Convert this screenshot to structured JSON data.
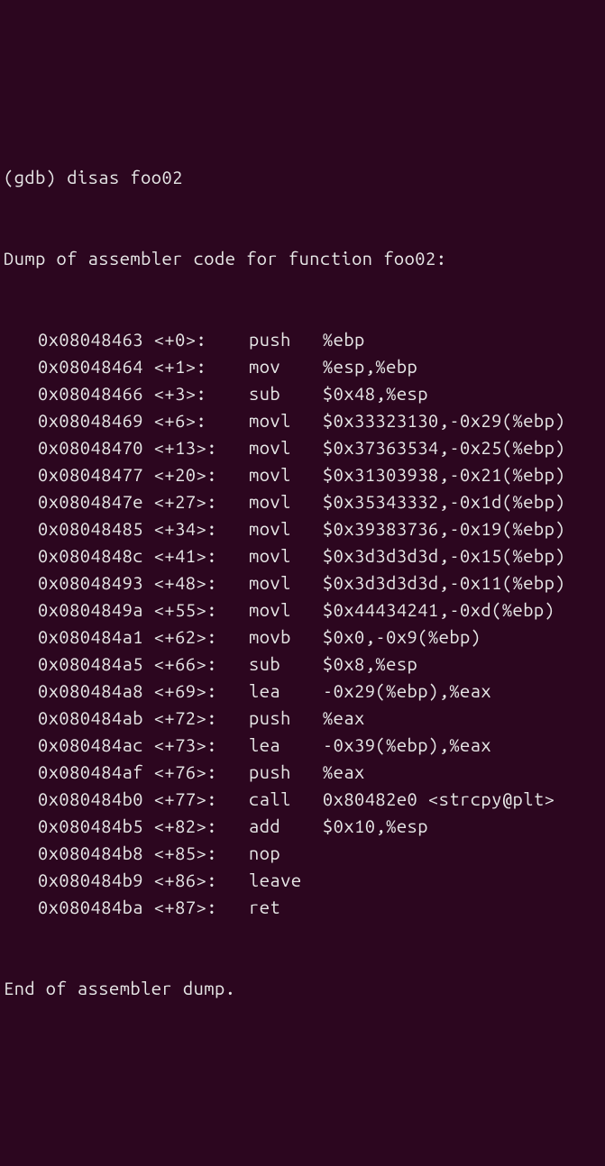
{
  "terminal": {
    "prompt": "(gdb) ",
    "command": "disas foo02",
    "header": "Dump of assembler code for function foo02:",
    "footer": "End of assembler dump.",
    "rows": [
      {
        "addr": "0x08048463",
        "offset": "<+0>:    ",
        "mnemonic": "push   ",
        "operands": "%ebp"
      },
      {
        "addr": "0x08048464",
        "offset": "<+1>:    ",
        "mnemonic": "mov    ",
        "operands": "%esp,%ebp"
      },
      {
        "addr": "0x08048466",
        "offset": "<+3>:    ",
        "mnemonic": "sub    ",
        "operands": "$0x48,%esp"
      },
      {
        "addr": "0x08048469",
        "offset": "<+6>:    ",
        "mnemonic": "movl   ",
        "operands": "$0x33323130,-0x29(%ebp)"
      },
      {
        "addr": "0x08048470",
        "offset": "<+13>:   ",
        "mnemonic": "movl   ",
        "operands": "$0x37363534,-0x25(%ebp)"
      },
      {
        "addr": "0x08048477",
        "offset": "<+20>:   ",
        "mnemonic": "movl   ",
        "operands": "$0x31303938,-0x21(%ebp)"
      },
      {
        "addr": "0x0804847e",
        "offset": "<+27>:   ",
        "mnemonic": "movl   ",
        "operands": "$0x35343332,-0x1d(%ebp)"
      },
      {
        "addr": "0x08048485",
        "offset": "<+34>:   ",
        "mnemonic": "movl   ",
        "operands": "$0x39383736,-0x19(%ebp)"
      },
      {
        "addr": "0x0804848c",
        "offset": "<+41>:   ",
        "mnemonic": "movl   ",
        "operands": "$0x3d3d3d3d,-0x15(%ebp)"
      },
      {
        "addr": "0x08048493",
        "offset": "<+48>:   ",
        "mnemonic": "movl   ",
        "operands": "$0x3d3d3d3d,-0x11(%ebp)"
      },
      {
        "addr": "0x0804849a",
        "offset": "<+55>:   ",
        "mnemonic": "movl   ",
        "operands": "$0x44434241,-0xd(%ebp)"
      },
      {
        "addr": "0x080484a1",
        "offset": "<+62>:   ",
        "mnemonic": "movb   ",
        "operands": "$0x0,-0x9(%ebp)"
      },
      {
        "addr": "0x080484a5",
        "offset": "<+66>:   ",
        "mnemonic": "sub    ",
        "operands": "$0x8,%esp"
      },
      {
        "addr": "0x080484a8",
        "offset": "<+69>:   ",
        "mnemonic": "lea    ",
        "operands": "-0x29(%ebp),%eax"
      },
      {
        "addr": "0x080484ab",
        "offset": "<+72>:   ",
        "mnemonic": "push   ",
        "operands": "%eax"
      },
      {
        "addr": "0x080484ac",
        "offset": "<+73>:   ",
        "mnemonic": "lea    ",
        "operands": "-0x39(%ebp),%eax"
      },
      {
        "addr": "0x080484af",
        "offset": "<+76>:   ",
        "mnemonic": "push   ",
        "operands": "%eax"
      },
      {
        "addr": "0x080484b0",
        "offset": "<+77>:   ",
        "mnemonic": "call   ",
        "operands": "0x80482e0 <strcpy@plt>"
      },
      {
        "addr": "0x080484b5",
        "offset": "<+82>:   ",
        "mnemonic": "add    ",
        "operands": "$0x10,%esp"
      },
      {
        "addr": "0x080484b8",
        "offset": "<+85>:   ",
        "mnemonic": "nop",
        "operands": ""
      },
      {
        "addr": "0x080484b9",
        "offset": "<+86>:   ",
        "mnemonic": "leave",
        "operands": ""
      },
      {
        "addr": "0x080484ba",
        "offset": "<+87>:   ",
        "mnemonic": "ret",
        "operands": ""
      }
    ]
  }
}
